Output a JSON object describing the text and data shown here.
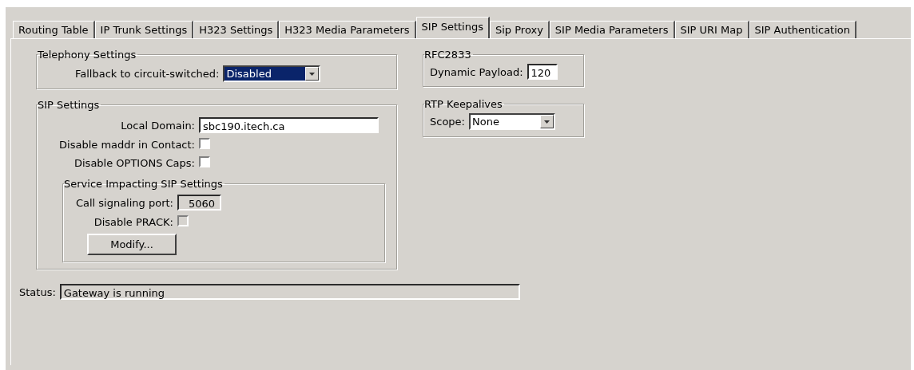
{
  "tabs": [
    {
      "label": "Routing Table",
      "selected": false
    },
    {
      "label": "IP Trunk Settings",
      "selected": false
    },
    {
      "label": "H323 Settings",
      "selected": false
    },
    {
      "label": "H323 Media Parameters",
      "selected": false
    },
    {
      "label": "SIP Settings",
      "selected": true
    },
    {
      "label": "Sip Proxy",
      "selected": false
    },
    {
      "label": "SIP Media Parameters",
      "selected": false
    },
    {
      "label": "SIP URI Map",
      "selected": false
    },
    {
      "label": "SIP Authentication",
      "selected": false
    }
  ],
  "telephony_settings": {
    "title": "Telephony Settings",
    "fallback": {
      "label": "Fallback to circuit-switched:",
      "value": "Disabled",
      "focused": true
    }
  },
  "sip_settings": {
    "title": "SIP Settings",
    "local_domain": {
      "label": "Local Domain:",
      "value": "sbc190.itech.ca"
    },
    "disable_maddr": {
      "label": "Disable maddr in Contact:",
      "checked": false,
      "disabled": false
    },
    "disable_options_caps": {
      "label": "Disable OPTIONS Caps:",
      "checked": false,
      "disabled": false
    },
    "service_impacting": {
      "title": "Service Impacting SIP Settings",
      "call_signaling_port": {
        "label": "Call signaling port:",
        "value": "5060",
        "disabled": true
      },
      "disable_prack": {
        "label": "Disable PRACK:",
        "checked": false,
        "disabled": true
      },
      "modify_button": "Modify..."
    }
  },
  "rfc2833": {
    "title": "RFC2833",
    "dynamic_payload": {
      "label": "Dynamic Payload:",
      "value": "120"
    }
  },
  "rtp_keepalives": {
    "title": "RTP Keepalives",
    "scope": {
      "label": "Scope:",
      "value": "None",
      "focused": false
    }
  },
  "status": {
    "label": "Status:",
    "value": "Gateway is running"
  }
}
